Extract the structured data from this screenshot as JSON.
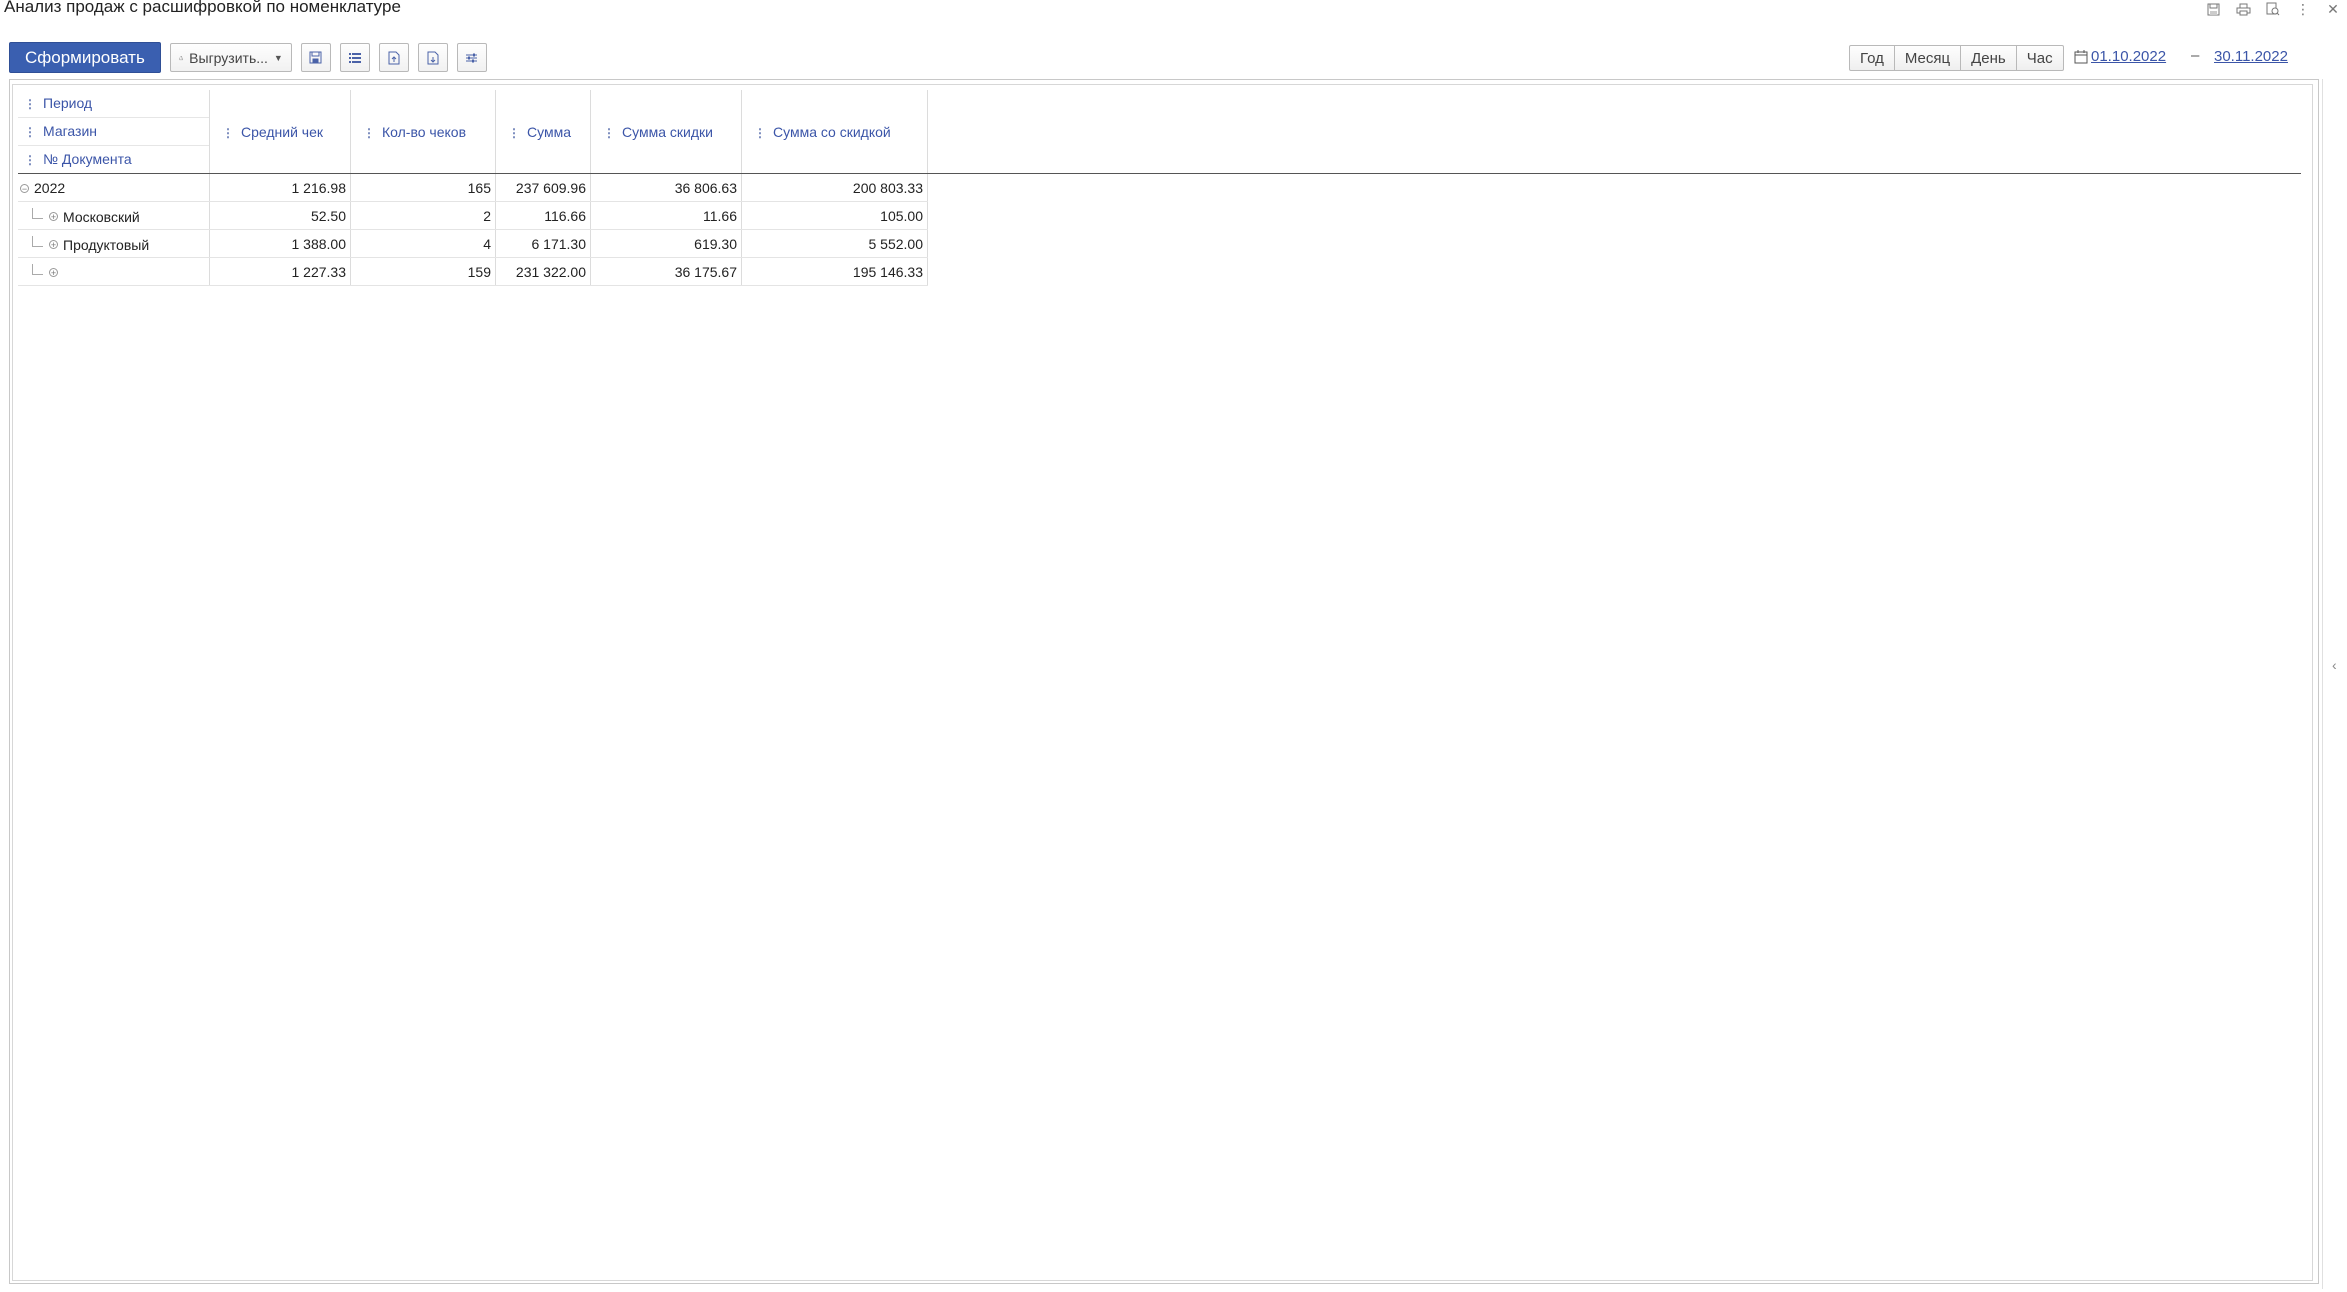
{
  "window": {
    "title": "Анализ продаж с расшифровкой по номенклатуре",
    "icons": [
      "save-icon",
      "print-icon",
      "preview-icon",
      "more-icon",
      "close-icon"
    ]
  },
  "toolbar": {
    "generate_label": "Сформировать",
    "export_label": "Выгрузить...",
    "icon_buttons": [
      "save-icon",
      "list-icon",
      "doc-export-icon",
      "doc-import-icon",
      "settings-icon"
    ]
  },
  "period": {
    "options": [
      "Год",
      "Месяц",
      "День",
      "Час"
    ],
    "date_from": "01.10.2022",
    "date_dash": "–",
    "date_to": "30.11.2022"
  },
  "report": {
    "row_headers": [
      "Период",
      "Магазин",
      "№ Документа"
    ],
    "columns": [
      "Средний чек",
      "Кол-во чеков",
      "Сумма",
      "Сумма скидки",
      "Сумма со скидкой"
    ],
    "rows": [
      {
        "label": "2022",
        "level": 0,
        "values": [
          "1 216.98",
          "165",
          "237 609.96",
          "36 806.63",
          "200 803.33"
        ]
      },
      {
        "label": "Московский",
        "level": 1,
        "values": [
          "52.50",
          "2",
          "116.66",
          "11.66",
          "105.00"
        ]
      },
      {
        "label": "Продуктовый",
        "level": 1,
        "values": [
          "1 388.00",
          "4",
          "6 171.30",
          "619.30",
          "5 552.00"
        ]
      },
      {
        "label": "",
        "level": 1,
        "values": [
          "1 227.33",
          "159",
          "231 322.00",
          "36 175.67",
          "195 146.33"
        ]
      }
    ]
  }
}
